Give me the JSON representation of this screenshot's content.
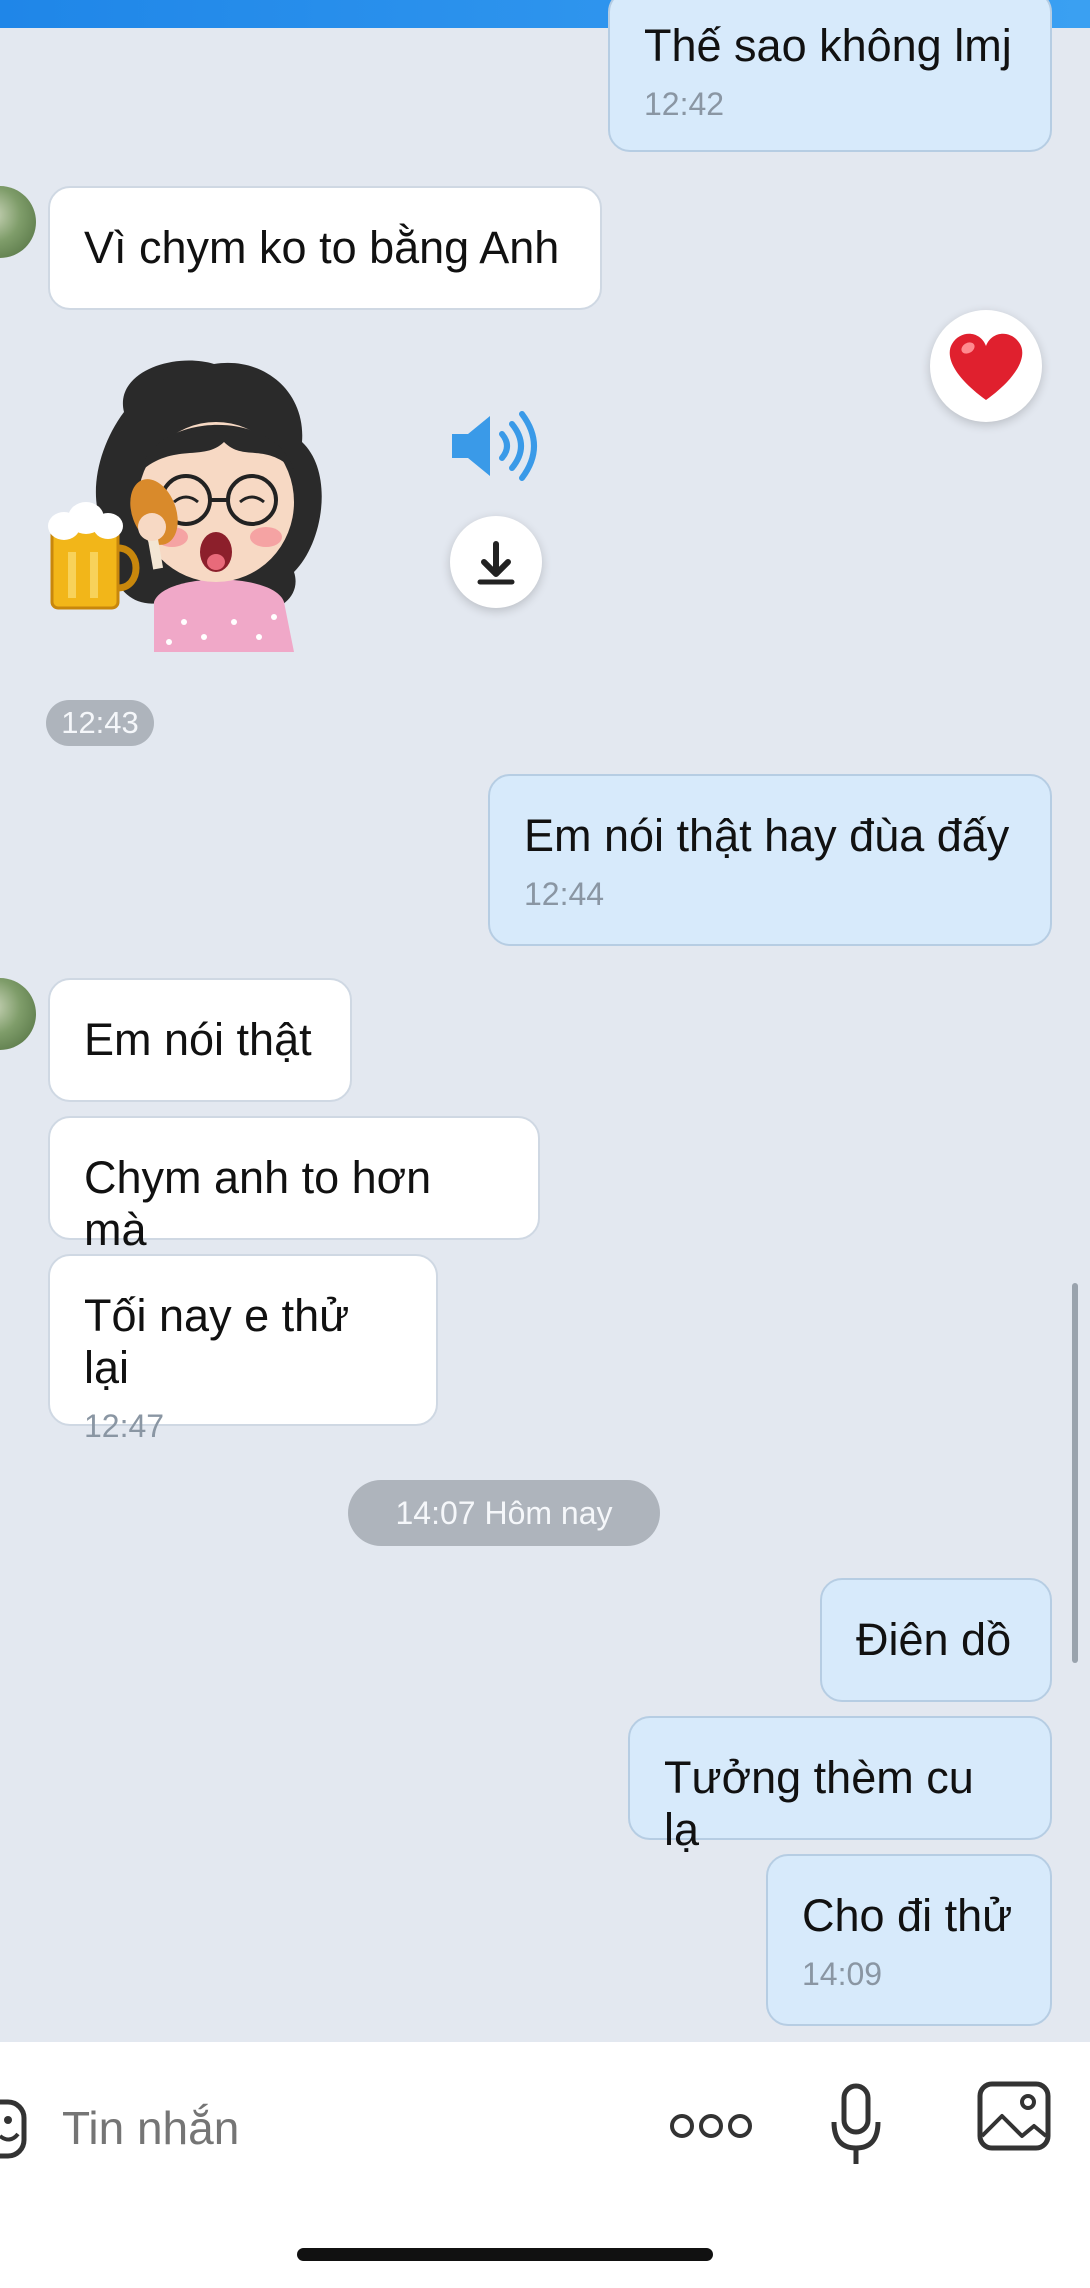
{
  "messages": [
    {
      "id": "m1",
      "dir": "out",
      "text": "Thế sao không lmj",
      "time": "12:42"
    },
    {
      "id": "m2",
      "dir": "in",
      "text": "Vì chym ko to bằng Anh"
    },
    {
      "id": "m3",
      "dir": "in",
      "type": "sticker",
      "sticker": "girl-with-beer-sticker",
      "time": "12:43"
    },
    {
      "id": "m4",
      "dir": "out",
      "text": "Em nói thật hay đùa đấy",
      "time": "12:44"
    },
    {
      "id": "m5",
      "dir": "in",
      "text": "Em nói thật"
    },
    {
      "id": "m6",
      "dir": "in",
      "text": "Chym anh to hơn mà"
    },
    {
      "id": "m7",
      "dir": "in",
      "text": "Tối nay e thử lại",
      "time": "12:47"
    },
    {
      "id": "m8",
      "dir": "out",
      "text": "Điên dồ"
    },
    {
      "id": "m9",
      "dir": "out",
      "text": "Tưởng thèm cu lạ"
    },
    {
      "id": "m10",
      "dir": "out",
      "text": "Cho đi thử",
      "time": "14:09"
    }
  ],
  "date_separator": "14:07 Hôm nay",
  "reaction": {
    "icon": "heart-icon",
    "color": "#e0202e"
  },
  "sticker_actions": {
    "speaker_icon": "speaker-icon",
    "download_icon": "download-icon"
  },
  "composer": {
    "placeholder": "Tin nhắn",
    "icons": [
      "emoji-icon",
      "more-icon",
      "microphone-icon",
      "image-icon"
    ]
  },
  "colors": {
    "accent": "#1f86e8",
    "bubble_out": "#d7eafb",
    "bubble_in": "#ffffff",
    "background": "#e3e8f0"
  }
}
